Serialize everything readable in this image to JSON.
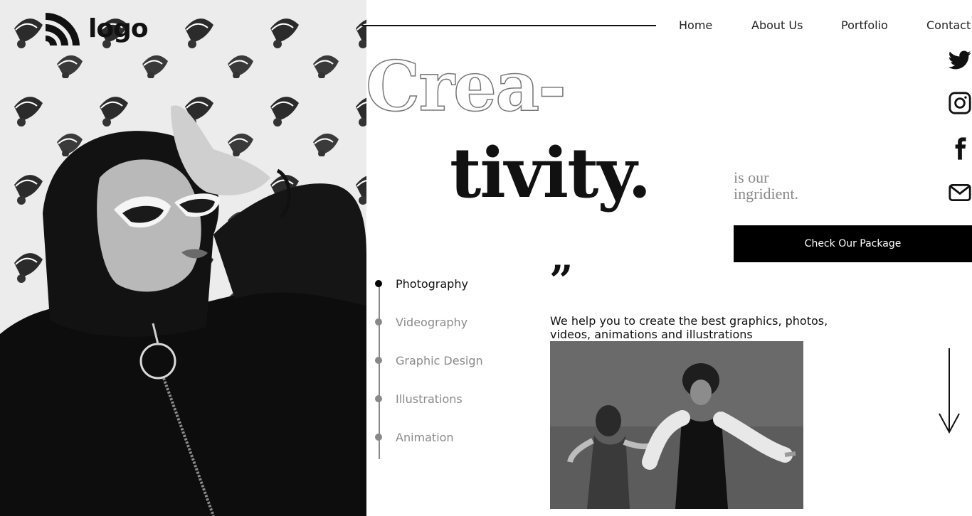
{
  "logo": {
    "text": "logo",
    "icon": "rss-arcs-icon"
  },
  "nav": {
    "items": [
      {
        "label": "Home"
      },
      {
        "label": "About Us"
      },
      {
        "label": "Portfolio"
      },
      {
        "label": "Contact"
      }
    ]
  },
  "social": [
    "twitter-icon",
    "instagram-icon",
    "facebook-icon",
    "mail-icon"
  ],
  "hero": {
    "title_outline": "Crea-",
    "title_solid": "tivity.",
    "tagline_line1": "is our",
    "tagline_line2": "ingridient.",
    "cta_label": "Check Our Package"
  },
  "services": {
    "items": [
      {
        "label": "Photography",
        "active": true
      },
      {
        "label": "Videography",
        "active": false
      },
      {
        "label": "Graphic Design",
        "active": false
      },
      {
        "label": "Illustrations",
        "active": false
      },
      {
        "label": "Animation",
        "active": false
      }
    ]
  },
  "quote": {
    "mark": "”",
    "text": "We help you to create the best graphics, photos, videos, animations and illustrations"
  },
  "colors": {
    "accent": "#000000",
    "muted": "#8a8a8a",
    "background": "#ffffff"
  }
}
